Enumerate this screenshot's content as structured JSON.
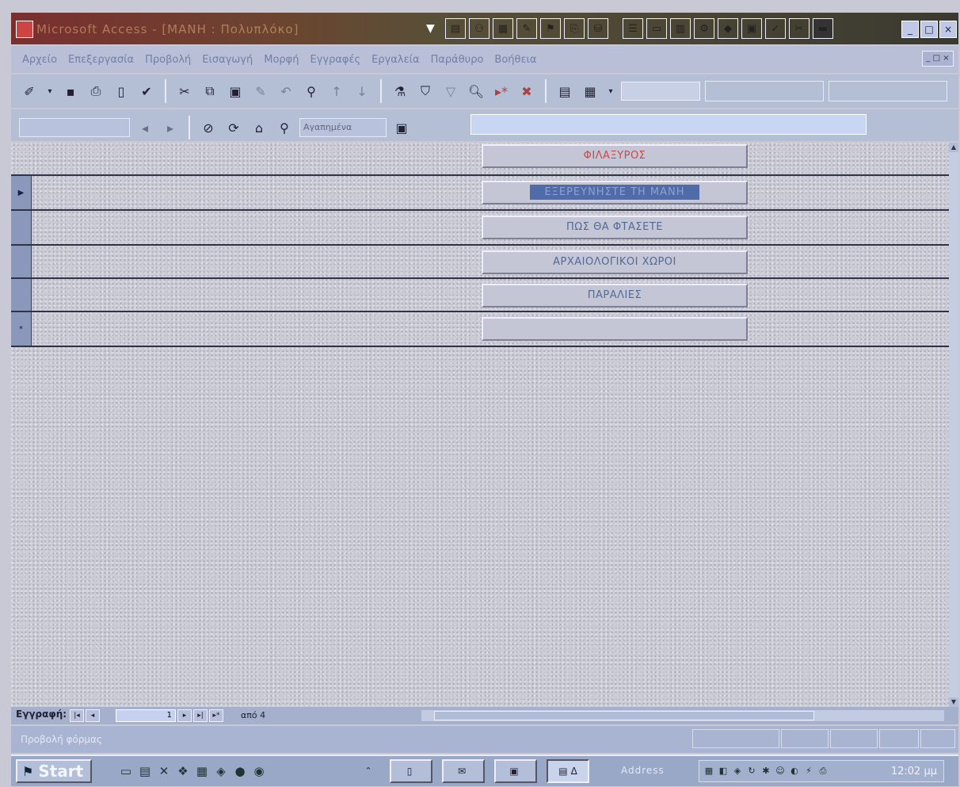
{
  "window": {
    "title": "Microsoft Access - [ΜΑΝΗ : Πολυπλόκο]",
    "icons": [
      "form-icon",
      "query-icon",
      "table-icon",
      "report-icon",
      "macro-icon",
      "module-icon",
      "db-icon",
      "list-icon",
      "browse-icon",
      "chart-icon",
      "diamond-icon",
      "calc-icon",
      "check-icon",
      "tools-icon",
      "monitor-icon"
    ],
    "min_label": "_",
    "max_label": "□",
    "close_label": "×"
  },
  "menubar": {
    "items": [
      "Αρχείο",
      "Επεξεργασία",
      "Προβολή",
      "Εισαγωγή",
      "Μορφή",
      "Εγγραφές",
      "Εργαλεία",
      "Παράθυρο",
      "Βοήθεια"
    ],
    "close_label": "_ □ ×"
  },
  "toolbar1": {
    "zoom": ""
  },
  "toolbar2": {
    "combo_value": "",
    "favorites_label": "Αγαπημένα",
    "address_value": ""
  },
  "form": {
    "header_button": "ΦΙΛΑΞΥΡΟΣ",
    "rows": [
      {
        "label": "ΕΞΕΡΕΥΝΗΣΤΕ ΤΗ ΜΑΝΗ",
        "selected": true,
        "selector": "▶"
      },
      {
        "label": "ΠΩΣ ΘΑ ΦΤΑΣΕΤΕ",
        "selected": false,
        "selector": ""
      },
      {
        "label": "ΑΡΧΑΙΟΛΟΓΙΚΟΙ ΧΩΡΟΙ",
        "selected": false,
        "selector": ""
      },
      {
        "label": "ΠΑΡΑΛΙΕΣ",
        "selected": false,
        "selector": ""
      },
      {
        "label": "",
        "selected": false,
        "selector": "*"
      }
    ]
  },
  "navbar": {
    "label": "Εγγραφή:",
    "record_number": "1",
    "of_text": "από 4"
  },
  "statusbar": {
    "text": "Προβολή φόρμας"
  },
  "taskbar": {
    "start_label": "Start",
    "address_label": "Address",
    "clock": "12:02 μμ",
    "task_buttons": [
      "",
      "",
      "",
      "Δ"
    ]
  }
}
